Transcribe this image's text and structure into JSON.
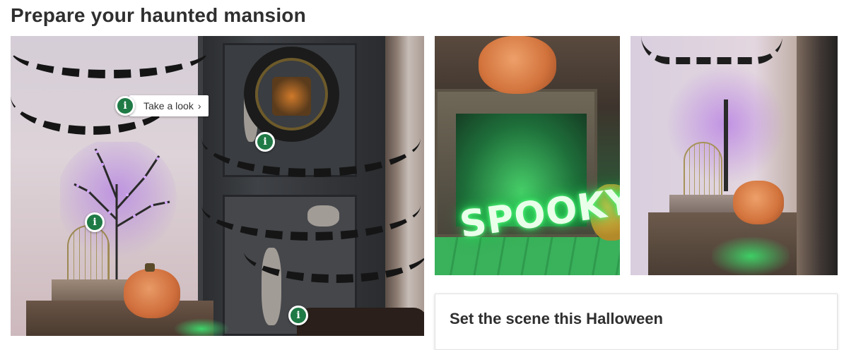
{
  "page": {
    "title": "Prepare your haunted mansion"
  },
  "main_image": {
    "hotspots": [
      {
        "icon": "info-icon",
        "glyph": "i"
      },
      {
        "icon": "info-icon",
        "glyph": "i"
      },
      {
        "icon": "info-icon",
        "glyph": "i"
      },
      {
        "icon": "info-icon",
        "glyph": "i"
      }
    ],
    "tooltip": {
      "glyph": "i",
      "label": "Take a look",
      "chevron": "›"
    }
  },
  "thumb1": {
    "neon_text": "SPOOKY"
  },
  "card": {
    "title": "Set the scene this Halloween"
  },
  "colors": {
    "hotspot_green": "#1f7a45",
    "title_text": "#2f2f2f"
  }
}
